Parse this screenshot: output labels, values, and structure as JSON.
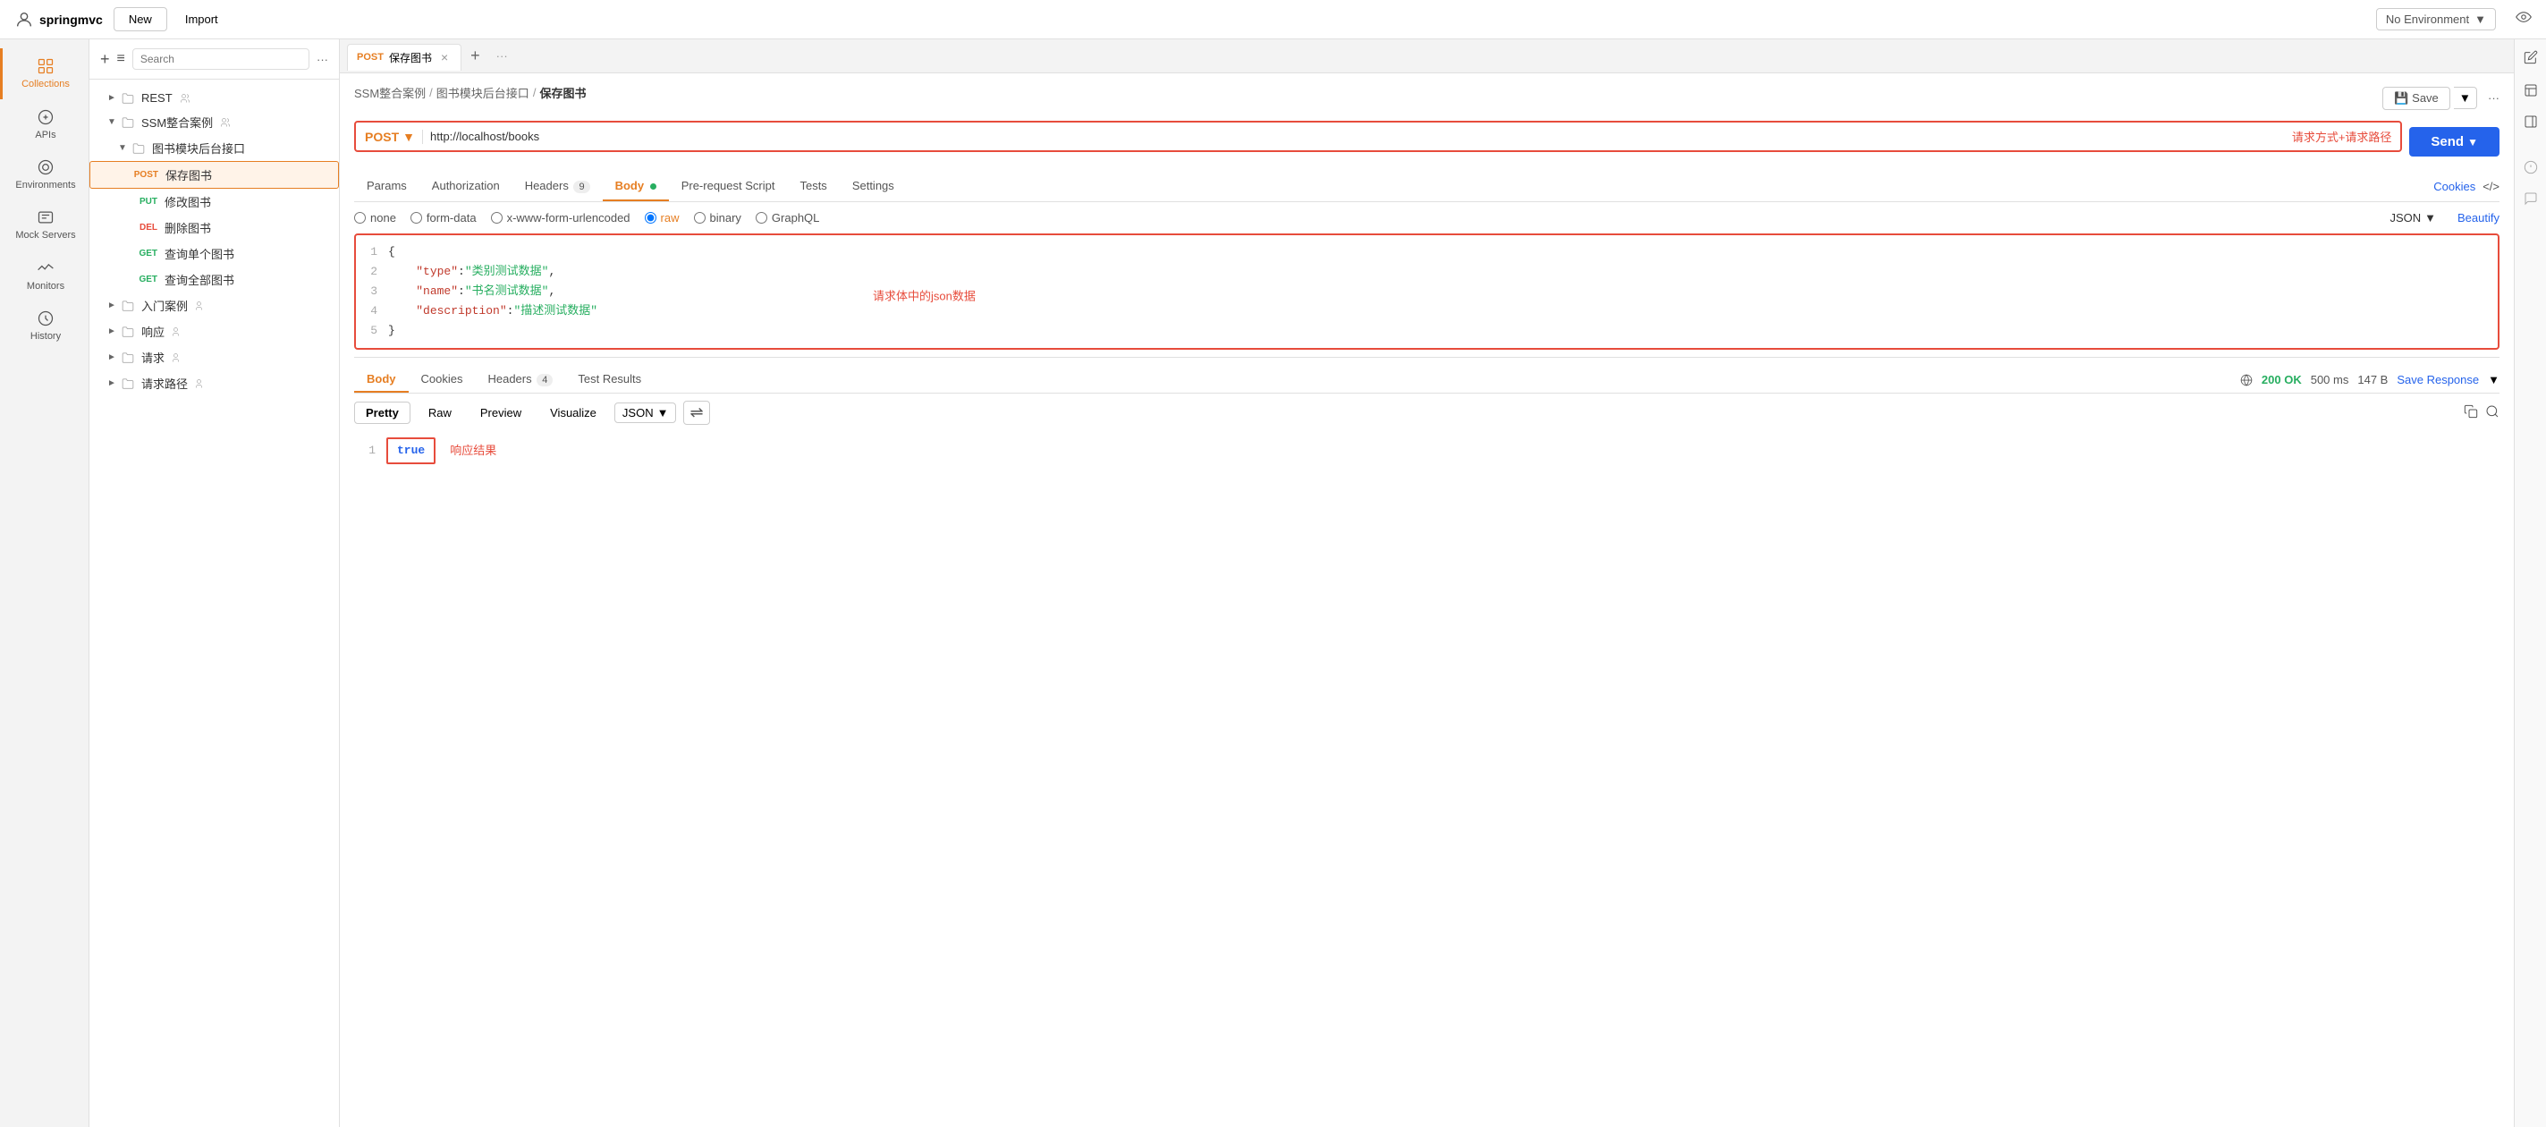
{
  "app": {
    "title": "springmvc",
    "new_btn": "New",
    "import_btn": "Import"
  },
  "env_selector": {
    "label": "No Environment",
    "dropdown_arrow": "▼"
  },
  "sidebar": {
    "collections_label": "Collections",
    "mock_servers_label": "Mock Servers",
    "history_label": "History",
    "apis_label": "APIs",
    "environments_label": "Environments",
    "monitors_label": "Monitors"
  },
  "collections_tree": {
    "items": [
      {
        "id": "rest",
        "label": "REST",
        "type": "collection",
        "indent": 1,
        "has_arrow": true,
        "arrow": "►"
      },
      {
        "id": "ssm",
        "label": "SSM整合案例",
        "type": "collection",
        "indent": 1,
        "has_arrow": true,
        "arrow": "▼",
        "expanded": true
      },
      {
        "id": "books-folder",
        "label": "图书模块后台接口",
        "type": "folder",
        "indent": 2,
        "has_arrow": true,
        "arrow": "▼",
        "expanded": true
      },
      {
        "id": "save-book",
        "label": "保存图书",
        "type": "request",
        "method": "POST",
        "indent": 3,
        "active": true
      },
      {
        "id": "edit-book",
        "label": "修改图书",
        "type": "request",
        "method": "PUT",
        "indent": 3
      },
      {
        "id": "delete-book",
        "label": "删除图书",
        "type": "request",
        "method": "DEL",
        "indent": 3
      },
      {
        "id": "get-book",
        "label": "查询单个图书",
        "type": "request",
        "method": "GET",
        "indent": 3
      },
      {
        "id": "get-all-books",
        "label": "查询全部图书",
        "type": "request",
        "method": "GET",
        "indent": 3
      },
      {
        "id": "intro",
        "label": "入门案例",
        "type": "collection",
        "indent": 1,
        "has_arrow": true,
        "arrow": "►"
      },
      {
        "id": "response",
        "label": "响应",
        "type": "collection",
        "indent": 1,
        "has_arrow": true,
        "arrow": "►"
      },
      {
        "id": "request",
        "label": "请求",
        "type": "collection",
        "indent": 1,
        "has_arrow": true,
        "arrow": "►"
      },
      {
        "id": "request-path",
        "label": "请求路径",
        "type": "collection",
        "indent": 1,
        "has_arrow": true,
        "arrow": "►"
      }
    ]
  },
  "tab": {
    "method": "POST",
    "title": "保存图书",
    "close": "×",
    "add": "+"
  },
  "breadcrumb": {
    "part1": "SSM整合案例",
    "sep1": "/",
    "part2": "图书模块后台接口",
    "sep2": "/",
    "current": "保存图书"
  },
  "url_bar": {
    "method": "POST",
    "url": "http://localhost/books",
    "annotation": "请求方式+请求路径",
    "send_btn": "Send",
    "dropdown_arrow": "▼"
  },
  "request_tabs": {
    "params": "Params",
    "authorization": "Authorization",
    "headers": "Headers",
    "headers_count": "9",
    "body": "Body",
    "pre_request": "Pre-request Script",
    "tests": "Tests",
    "settings": "Settings",
    "cookies": "Cookies",
    "code": "</>"
  },
  "body_types": {
    "none": "none",
    "form_data": "form-data",
    "urlencoded": "x-www-form-urlencoded",
    "raw": "raw",
    "binary": "binary",
    "graphql": "GraphQL",
    "format": "JSON",
    "beautify": "Beautify"
  },
  "code_editor": {
    "annotation": "请求体中的json数据",
    "lines": [
      {
        "num": "1",
        "content": "{"
      },
      {
        "num": "2",
        "content": "    \"type\":\"类别测试数据\","
      },
      {
        "num": "3",
        "content": "    \"name\":\"书名测试数据\","
      },
      {
        "num": "4",
        "content": "    \"description\":\"描述测试数据\""
      },
      {
        "num": "5",
        "content": "}"
      }
    ]
  },
  "response": {
    "tabs": {
      "body": "Body",
      "cookies": "Cookies",
      "headers": "Headers",
      "headers_count": "4",
      "test_results": "Test Results"
    },
    "status": "200 OK",
    "time": "500 ms",
    "size": "147 B",
    "save_response": "Save Response",
    "format_tabs": {
      "pretty": "Pretty",
      "raw": "Raw",
      "preview": "Preview",
      "visualize": "Visualize"
    },
    "format": "JSON",
    "body_line1_num": "1",
    "body_value": "true",
    "annotation": "响应结果"
  },
  "save_area": {
    "save_icon": "💾",
    "save_label": "Save",
    "dropdown": "▼",
    "more": "···"
  },
  "top_right": {
    "edit_icon": "✏",
    "layout_icon": "▣",
    "panel_icon": "▤"
  },
  "icons": {
    "eye": "👁",
    "collections": "☰",
    "apis": "⊡",
    "environments": "⊙",
    "mock": "⊞",
    "monitors": "☰",
    "history": "↺",
    "plus": "+",
    "filter": "≡",
    "more": "···",
    "arrow_down": "▼",
    "chevron": "›"
  }
}
